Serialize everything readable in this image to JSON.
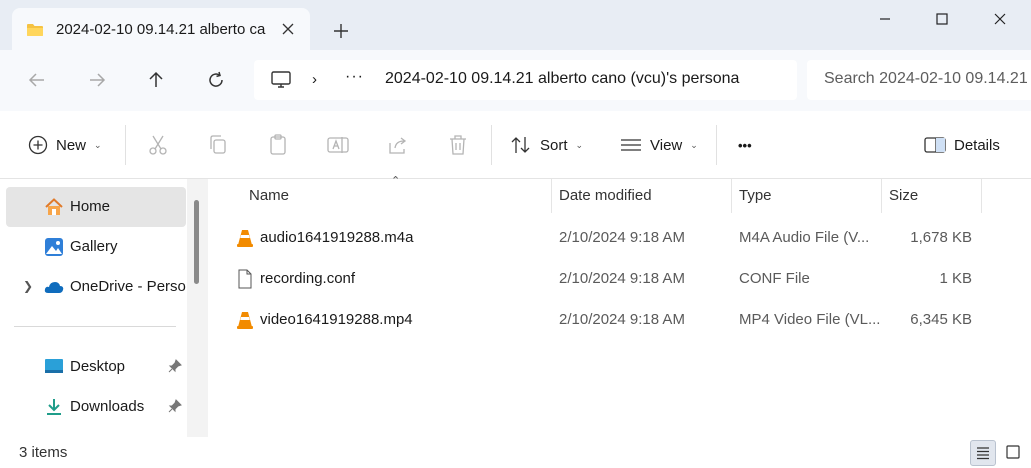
{
  "tab": {
    "title": "2024-02-10 09.14.21 alberto ca"
  },
  "address": {
    "path": "2024-02-10 09.14.21 alberto cano (vcu)'s persona",
    "chevron": "›",
    "dots": "···"
  },
  "search": {
    "placeholder": "Search 2024-02-10 09.14.21 a"
  },
  "toolbar": {
    "new_label": "New",
    "sort_label": "Sort",
    "view_label": "View",
    "more_label": "•••",
    "details_label": "Details"
  },
  "sidebar": {
    "items": [
      {
        "label": "Home",
        "icon": "home-icon"
      },
      {
        "label": "Gallery",
        "icon": "gallery-icon"
      },
      {
        "label": "OneDrive - Persor",
        "icon": "cloud-icon"
      },
      {
        "label": "Desktop",
        "icon": "desktop-icon"
      },
      {
        "label": "Downloads",
        "icon": "download-icon"
      }
    ]
  },
  "columns": {
    "name": "Name",
    "date": "Date modified",
    "type": "Type",
    "size": "Size"
  },
  "files": [
    {
      "name": "audio1641919288.m4a",
      "date": "2/10/2024 9:18 AM",
      "type": "M4A Audio File (V...",
      "size": "1,678 KB",
      "icon": "vlc-icon"
    },
    {
      "name": "recording.conf",
      "date": "2/10/2024 9:18 AM",
      "type": "CONF File",
      "size": "1 KB",
      "icon": "file-icon"
    },
    {
      "name": "video1641919288.mp4",
      "date": "2/10/2024 9:18 AM",
      "type": "MP4 Video File (VL...",
      "size": "6,345 KB",
      "icon": "vlc-icon"
    }
  ],
  "status": {
    "items_count": "3 items"
  },
  "colors": {
    "accent": "#0067c0",
    "vlc_orange": "#f28b00",
    "titlebar_bg": "#e8edf4"
  }
}
